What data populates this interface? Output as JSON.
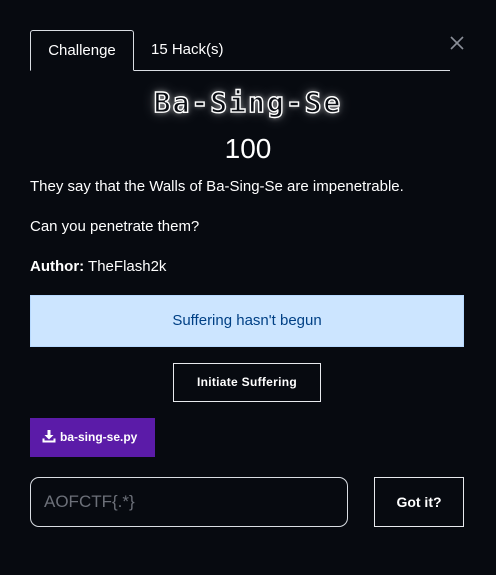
{
  "modal": {
    "close_glyph": "×"
  },
  "tabs": [
    {
      "label": "Challenge",
      "active": true
    },
    {
      "label": "15 Hack(s)",
      "active": false
    }
  ],
  "challenge": {
    "name": "Ba-Sing-Se",
    "points": "100",
    "description_line_1": "They say that the Walls of Ba-Sing-Se are impenetrable.",
    "description_line_2": "Can you penetrate them?",
    "author_label": "Author:",
    "author_name": " TheFlash2k"
  },
  "status": {
    "message": "Suffering hasn't begun",
    "background": "#cce5ff",
    "text_color": "#004085"
  },
  "actions": {
    "initiate_label": "Initiate Suffering",
    "file_label": "ba-sing-se.py",
    "file_icon": "download-icon",
    "file_color": "#5b1ba8"
  },
  "submission": {
    "placeholder": "AOFCTF{.*}",
    "value": "",
    "submit_label": "Got it?"
  }
}
